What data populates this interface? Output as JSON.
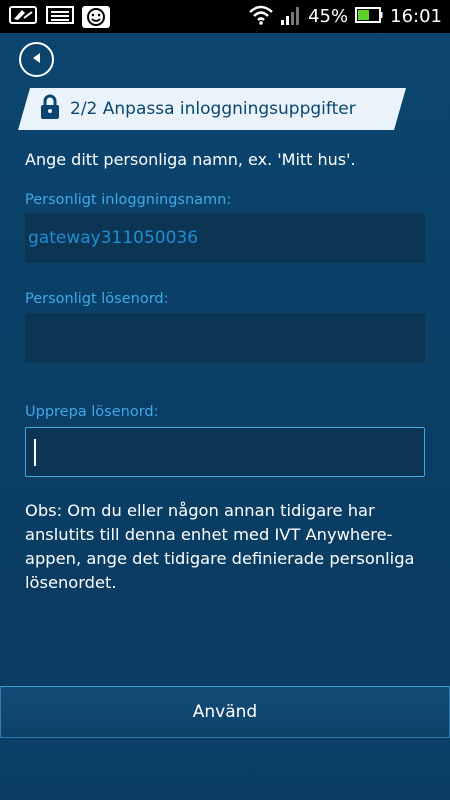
{
  "status_bar": {
    "battery_percent": "45%",
    "time": "16:01",
    "icons": [
      "notification-card-icon",
      "gallery-icon",
      "smiley-app-icon",
      "wifi-icon",
      "signal-icon",
      "battery-icon"
    ]
  },
  "header": {
    "back_icon": "back-arrow-icon"
  },
  "step": {
    "title": "2/2 Anpassa inloggningsuppgifter",
    "icon": "lock-icon"
  },
  "intro_text": "Ange ditt personliga namn, ex. 'Mitt hus'.",
  "form": {
    "username_label": "Personligt inloggningsnamn:",
    "username_value": "gateway311050036",
    "password_label": "Personligt lösenord:",
    "password_value": "",
    "repeat_label": "Upprepa lösenord:",
    "repeat_value": ""
  },
  "note_text": "Obs: Om du eller någon annan tidigare har anslutits till denna enhet med IVT Anywhere-appen, ange det tidigare definierade personliga lösenordet.",
  "apply_button_label": "Använd",
  "colors": {
    "background": "#0b4670",
    "accent": "#3fa9e8",
    "field_background": "#0c3553",
    "banner_background": "#eaf3fa",
    "battery_green": "#5bd12a"
  }
}
